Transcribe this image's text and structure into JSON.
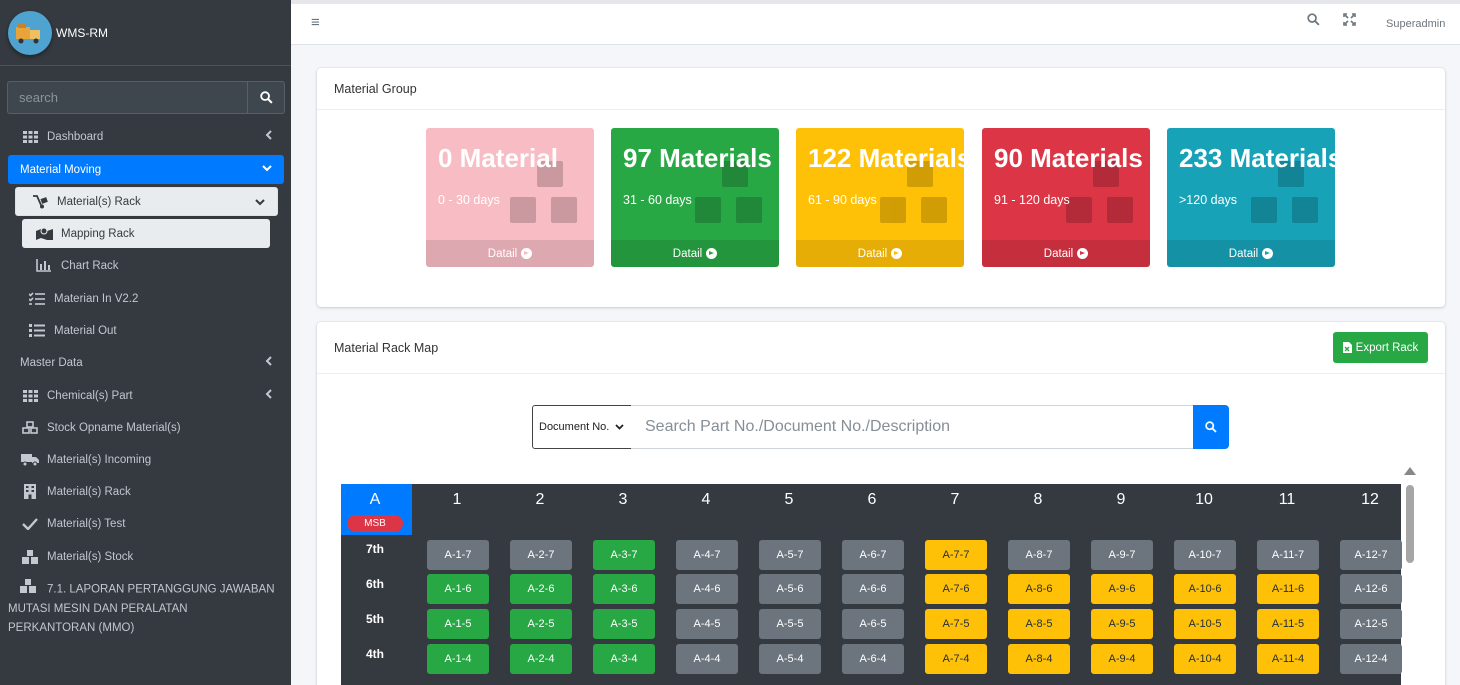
{
  "app": {
    "title": "WMS-RM"
  },
  "sidebar": {
    "search_placeholder": "search",
    "items": {
      "dashboard": "Dashboard",
      "material_moving": "Material Moving",
      "materials_rack_group": "Material(s) Rack",
      "mapping_rack": "Mapping Rack",
      "chart_rack": "Chart Rack",
      "material_in": "Materian In V2.2",
      "material_out": "Material Out",
      "master_data": "Master Data",
      "chemicals_part": "Chemical(s) Part",
      "stock_opname": "Stock Opname Material(s)",
      "materials_incoming": "Material(s) Incoming",
      "materials_rack": "Material(s) Rack",
      "materials_test": "Material(s) Test",
      "materials_stock": "Material(s) Stock",
      "laporan": "7.1. LAPORAN PERTANGGUNG JAWABAN MUTASI MESIN DAN PERALATAN PERKANTORAN (MMO)"
    }
  },
  "topbar": {
    "user": "Superadmin"
  },
  "material_group": {
    "title": "Material Group",
    "boxes": [
      {
        "count": "0 Material",
        "range": "0 - 30 days",
        "link": "Datail",
        "color": "#f8bcc4"
      },
      {
        "count": "97 Materials",
        "range": "31 - 60 days",
        "link": "Datail",
        "color": "#28a745"
      },
      {
        "count": "122 Materials",
        "range": "61 - 90 days",
        "link": "Datail",
        "color": "#ffc107"
      },
      {
        "count": "90 Materials",
        "range": "91 - 120 days",
        "link": "Datail",
        "color": "#dc3545"
      },
      {
        "count": "233 Materials",
        "range": ">120 days",
        "link": "Datail",
        "color": "#17a2b8"
      }
    ]
  },
  "rack_map": {
    "title": "Material Rack Map",
    "export_label": "Export Rack",
    "doc_select": "Document No.",
    "search_placeholder": "Search Part No./Document No./Description",
    "rack_name": "A",
    "rack_badge": "MSB",
    "columns": [
      "1",
      "2",
      "3",
      "4",
      "5",
      "6",
      "7",
      "8",
      "9",
      "10",
      "11",
      "12"
    ],
    "rows": [
      {
        "label": "7th",
        "level": "7",
        "status": [
          "gray",
          "gray",
          "green",
          "gray",
          "gray",
          "gray",
          "yellow",
          "gray",
          "gray",
          "gray",
          "gray",
          "gray"
        ]
      },
      {
        "label": "6th",
        "level": "6",
        "status": [
          "green",
          "green",
          "green",
          "gray",
          "gray",
          "gray",
          "yellow",
          "yellow",
          "yellow",
          "yellow",
          "yellow",
          "gray"
        ]
      },
      {
        "label": "5th",
        "level": "5",
        "status": [
          "green",
          "green",
          "green",
          "gray",
          "gray",
          "gray",
          "yellow",
          "yellow",
          "yellow",
          "yellow",
          "yellow",
          "gray"
        ]
      },
      {
        "label": "4th",
        "level": "4",
        "status": [
          "green",
          "green",
          "green",
          "gray",
          "gray",
          "gray",
          "yellow",
          "yellow",
          "yellow",
          "yellow",
          "yellow",
          "gray"
        ]
      }
    ]
  },
  "colors": {
    "sidebar": "#343a40",
    "primary": "#007bff",
    "success": "#28a745",
    "warning": "#ffc107",
    "danger": "#dc3545",
    "info": "#17a2b8",
    "secondary": "#6c757d"
  }
}
